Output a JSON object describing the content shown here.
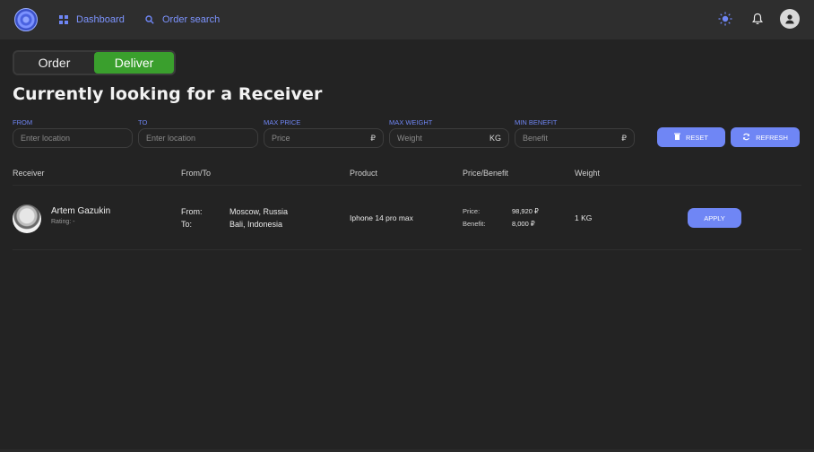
{
  "nav": {
    "dashboard_label": "Dashboard",
    "order_search_label": "Order search",
    "accent": "#6f86f5"
  },
  "toggle": {
    "options": [
      "Order",
      "Deliver"
    ],
    "active": "Deliver",
    "active_color": "#3a9f2d"
  },
  "page": {
    "title": "Currently looking for a Receiver"
  },
  "filters": {
    "from": {
      "label": "FROM",
      "placeholder": "Enter location"
    },
    "to": {
      "label": "TO",
      "placeholder": "Enter location"
    },
    "max_price": {
      "label": "MAX PRICE",
      "placeholder": "Price",
      "unit": "₽"
    },
    "max_weight": {
      "label": "MAX WEIGHT",
      "placeholder": "Weight",
      "unit": "KG"
    },
    "min_benefit": {
      "label": "MIN BENEFIT",
      "placeholder": "Benefit",
      "unit": "₽"
    }
  },
  "buttons": {
    "reset": "RESET",
    "refresh": "REFRESH"
  },
  "table": {
    "columns": [
      "Receiver",
      "From/To",
      "Product",
      "Price/Benefit",
      "Weight"
    ],
    "rows": [
      {
        "name": "Artem Gazukin",
        "rating": "Rating: -",
        "from_label": "From:",
        "from": "Moscow, Russia",
        "to_label": "To:",
        "to": "Bali, Indonesia",
        "product": "Iphone 14 pro max",
        "price_label": "Price:",
        "price": "98,920 ₽",
        "benefit_label": "Benefit:",
        "benefit": "8,000 ₽",
        "weight": "1 KG",
        "action": "APPLY"
      }
    ]
  }
}
